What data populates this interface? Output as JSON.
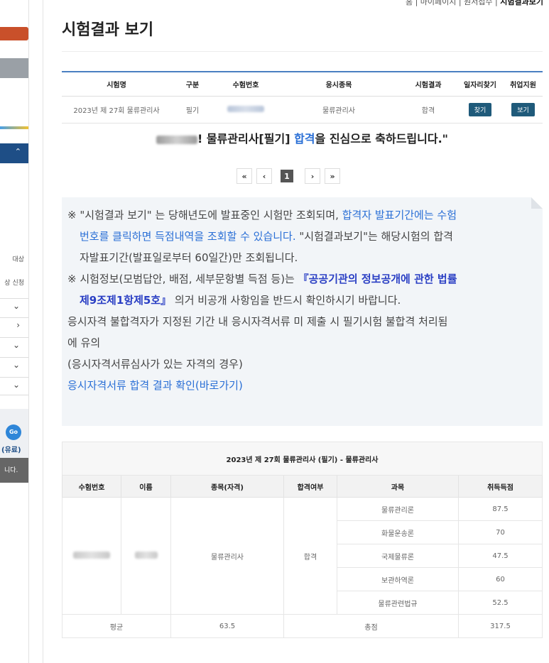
{
  "breadcrumb": {
    "trail": "홈 | 마이페이지 | 원서접수 |",
    "current": "시험결과보기"
  },
  "page_title": "시험결과 보기",
  "sidebar": {
    "items": [
      "대상",
      "상 신청",
      "⌄",
      "›",
      "⌄",
      "⌄",
      "⌄"
    ],
    "go_label": "Go",
    "paid_label": "(유료)",
    "footer_text": "니다."
  },
  "result_table": {
    "headers": [
      "시험명",
      "구분",
      "수험번호",
      "응시종목",
      "시험결과",
      "일자리찾기",
      "취업지원"
    ],
    "row": {
      "exam": "2023년 제 27회 물류관리사",
      "type": "필기",
      "subject": "물류관리사",
      "result": "합격",
      "job_btn": "찾기",
      "support_btn": "보기"
    }
  },
  "congrats": {
    "pre": "! 물류관리사[필기] ",
    "pass": "합격",
    "post": "을 진심으로 축하드립니다.\""
  },
  "pagination": {
    "first": "«",
    "prev": "‹",
    "page": "1",
    "next": "›",
    "last": "»"
  },
  "notice": {
    "p1_a": "※ \"시험결과 보기\" 는 당해년도에 발표중인 시험만 조회되며, ",
    "p1_b": "합격자 발표기간에는 수험",
    "p1_c": "번호를 클릭하면 득점내역을 조회할 수 있습니다.",
    "p1_d": " \"시험결과보기\"는 해당시험의 합격",
    "p1_e": "자발표기간(발표일로부터 60일간)만 조회됩니다.",
    "p2_a": "※ 시험정보(모범답안, 배점, 세부문항별 득점 등)는 ",
    "p2_b": "『공공기관의 정보공개에 관한 법률",
    "p2_c": "제9조제1항제5호』",
    "p2_d": " 의거 비공개 사항임을 반드시 확인하시기 바랍니다.",
    "p3": "응시자격 불합격자가 지정된 기간 내 응시자격서류 미 제출 시 필기시험 불합격 처리됨",
    "p3b": "에 유의",
    "p4": "(응시자격서류심사가 있는 자격의 경우)",
    "link": "응시자격서류 합격 결과 확인(바로가기)"
  },
  "score_table": {
    "caption": "2023년 제 27회 물류관리사 (필기) - 물류관리사",
    "headers": [
      "수험번호",
      "이름",
      "종목(자격)",
      "합격여부",
      "과목",
      "취득득점"
    ],
    "qualification": "물류관리사",
    "pass": "합격",
    "subjects": [
      {
        "name": "물류관리론",
        "score": "87.5"
      },
      {
        "name": "화물운송론",
        "score": "70"
      },
      {
        "name": "국제물류론",
        "score": "47.5"
      },
      {
        "name": "보관하역론",
        "score": "60"
      },
      {
        "name": "물류관련법규",
        "score": "52.5"
      }
    ],
    "avg_label": "평균",
    "avg": "63.5",
    "total_label": "총점",
    "total": "317.5"
  },
  "colors": {
    "accent": "#2a6fd6",
    "button": "#1f5a7a",
    "orange": "#c9502a",
    "table_top": "#4a7fc1"
  }
}
